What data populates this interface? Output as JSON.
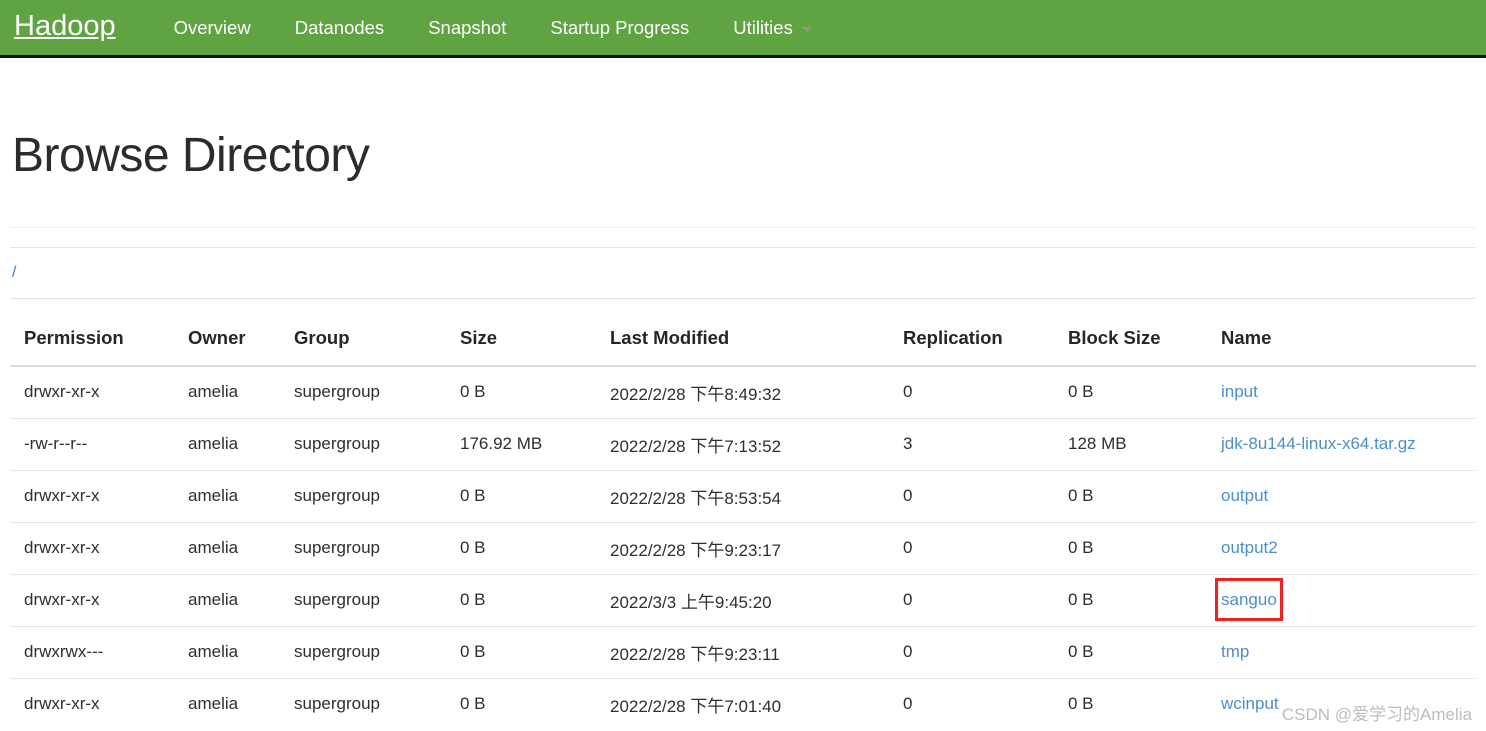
{
  "navbar": {
    "brand": "Hadoop",
    "accent_color": "#60a343",
    "items": [
      {
        "label": "Overview",
        "has_caret": false
      },
      {
        "label": "Datanodes",
        "has_caret": false
      },
      {
        "label": "Snapshot",
        "has_caret": false
      },
      {
        "label": "Startup Progress",
        "has_caret": false
      },
      {
        "label": "Utilities",
        "has_caret": true
      }
    ]
  },
  "main": {
    "page_title": "Browse Directory",
    "breadcrumb_path": "/",
    "table": {
      "columns": [
        "Permission",
        "Owner",
        "Group",
        "Size",
        "Last Modified",
        "Replication",
        "Block Size",
        "Name"
      ],
      "rows": [
        {
          "permission": "drwxr-xr-x",
          "owner": "amelia",
          "group": "supergroup",
          "size": "0 B",
          "last_modified": "2022/2/28 下午8:49:32",
          "replication": "0",
          "block_size": "0 B",
          "name": "input",
          "highlighted": false
        },
        {
          "permission": "-rw-r--r--",
          "owner": "amelia",
          "group": "supergroup",
          "size": "176.92 MB",
          "last_modified": "2022/2/28 下午7:13:52",
          "replication": "3",
          "block_size": "128 MB",
          "name": "jdk-8u144-linux-x64.tar.gz",
          "highlighted": false
        },
        {
          "permission": "drwxr-xr-x",
          "owner": "amelia",
          "group": "supergroup",
          "size": "0 B",
          "last_modified": "2022/2/28 下午8:53:54",
          "replication": "0",
          "block_size": "0 B",
          "name": "output",
          "highlighted": false
        },
        {
          "permission": "drwxr-xr-x",
          "owner": "amelia",
          "group": "supergroup",
          "size": "0 B",
          "last_modified": "2022/2/28 下午9:23:17",
          "replication": "0",
          "block_size": "0 B",
          "name": "output2",
          "highlighted": false
        },
        {
          "permission": "drwxr-xr-x",
          "owner": "amelia",
          "group": "supergroup",
          "size": "0 B",
          "last_modified": "2022/3/3 上午9:45:20",
          "replication": "0",
          "block_size": "0 B",
          "name": "sanguo",
          "highlighted": true
        },
        {
          "permission": "drwxrwx---",
          "owner": "amelia",
          "group": "supergroup",
          "size": "0 B",
          "last_modified": "2022/2/28 下午9:23:11",
          "replication": "0",
          "block_size": "0 B",
          "name": "tmp",
          "highlighted": false
        },
        {
          "permission": "drwxr-xr-x",
          "owner": "amelia",
          "group": "supergroup",
          "size": "0 B",
          "last_modified": "2022/2/28 下午7:01:40",
          "replication": "0",
          "block_size": "0 B",
          "name": "wcinput",
          "highlighted": false
        }
      ]
    }
  },
  "overlay": {
    "highlight_color": "#ee2222",
    "watermark": "CSDN @爱学习的Amelia"
  }
}
